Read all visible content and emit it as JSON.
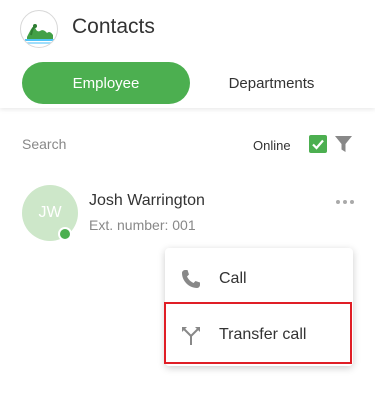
{
  "header": {
    "title": "Contacts"
  },
  "tabs": [
    {
      "label": "Employee",
      "active": true
    },
    {
      "label": "Departments",
      "active": false
    }
  ],
  "filters": {
    "search_label": "Search",
    "online_label": "Online",
    "online_checked": true
  },
  "contact": {
    "initials": "JW",
    "name": "Josh Warrington",
    "ext": "Ext. number: 001",
    "status": "online"
  },
  "menu": {
    "items": [
      {
        "label": "Call",
        "icon": "phone-icon"
      },
      {
        "label": "Transfer call",
        "icon": "transfer-icon"
      }
    ]
  },
  "colors": {
    "accent": "#4caf50",
    "avatar_bg": "#cde7c9",
    "highlight": "#e01e26"
  }
}
